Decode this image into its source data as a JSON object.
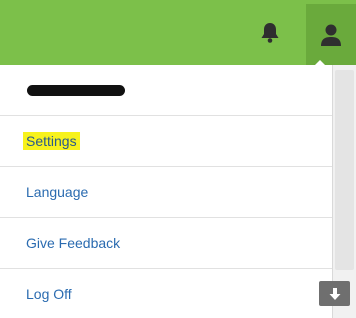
{
  "header": {
    "bell_icon": "bell-icon",
    "user_icon": "user-icon",
    "bar_color": "#7cc04a"
  },
  "menu": {
    "user_name_redacted": "",
    "items": [
      {
        "label": "Settings",
        "highlighted": true
      },
      {
        "label": "Language"
      },
      {
        "label": "Give Feedback"
      },
      {
        "label": "Log Off"
      }
    ]
  },
  "scroll_button": {
    "icon": "arrow-down-icon"
  }
}
